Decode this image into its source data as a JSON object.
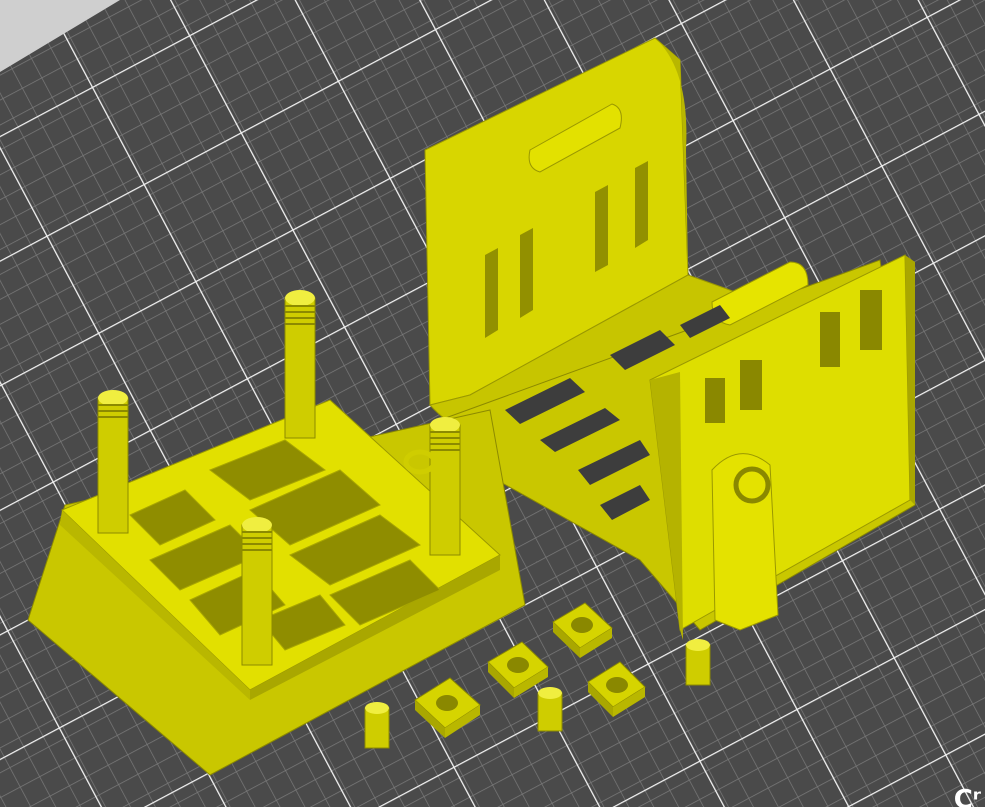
{
  "viewport": {
    "type": "3d-slicer-preview",
    "bed_color": "#4a4a4a",
    "grid_minor_color": "#7c7c7c",
    "grid_major_color": "#ffffff",
    "model_color": "#e8e600",
    "corner_label": "Cʳ"
  },
  "models": [
    {
      "name": "base-tray",
      "features": [
        "threaded-post",
        "threaded-post",
        "threaded-post",
        "threaded-post",
        "cell-grid"
      ]
    },
    {
      "name": "curved-bracket",
      "features": [
        "slots",
        "wire-clip",
        "hinge-pin"
      ]
    },
    {
      "name": "square-nut-1"
    },
    {
      "name": "square-nut-2"
    },
    {
      "name": "square-nut-3"
    },
    {
      "name": "small-pin-1"
    },
    {
      "name": "small-pin-2"
    },
    {
      "name": "small-pin-3"
    }
  ]
}
